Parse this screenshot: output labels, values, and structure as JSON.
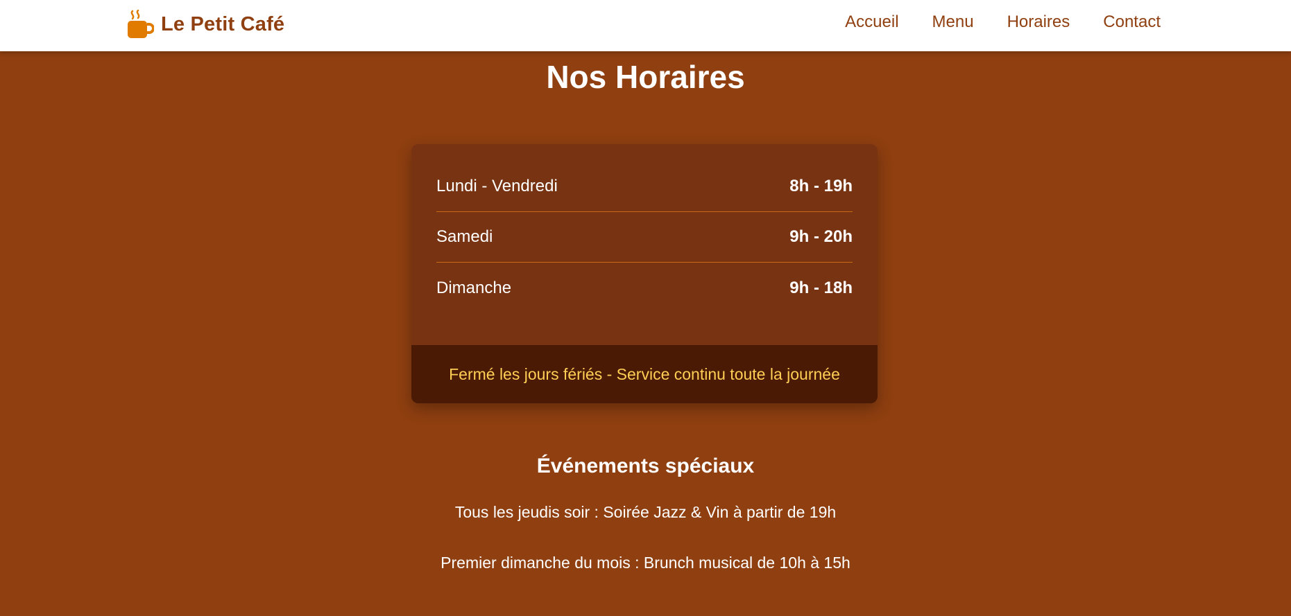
{
  "brand": {
    "name": "Le Petit Café",
    "icon": "coffee-cup-icon",
    "icon_color": "#e07b00"
  },
  "nav": {
    "links": [
      "Accueil",
      "Menu",
      "Horaires",
      "Contact"
    ]
  },
  "page": {
    "title": "Nos Horaires"
  },
  "hours": {
    "rows": [
      {
        "day": "Lundi - Vendredi",
        "time": "8h - 19h"
      },
      {
        "day": "Samedi",
        "time": "9h - 20h"
      },
      {
        "day": "Dimanche",
        "time": "9h - 18h"
      }
    ],
    "note": "Fermé les jours fériés - Service continu toute la journée"
  },
  "events": {
    "title": "Événements spéciaux",
    "items": [
      "Tous les jeudis soir : Soirée Jazz & Vin à partir de 19h",
      "Premier dimanche du mois : Brunch musical de 10h à 15h"
    ]
  },
  "colors": {
    "background": "#8f3f10",
    "card": "#783412",
    "card_footer": "#4a1a05",
    "accent_yellow": "#ffcf55",
    "brand_brown": "#8f3f10",
    "divider": "#c96a14"
  }
}
